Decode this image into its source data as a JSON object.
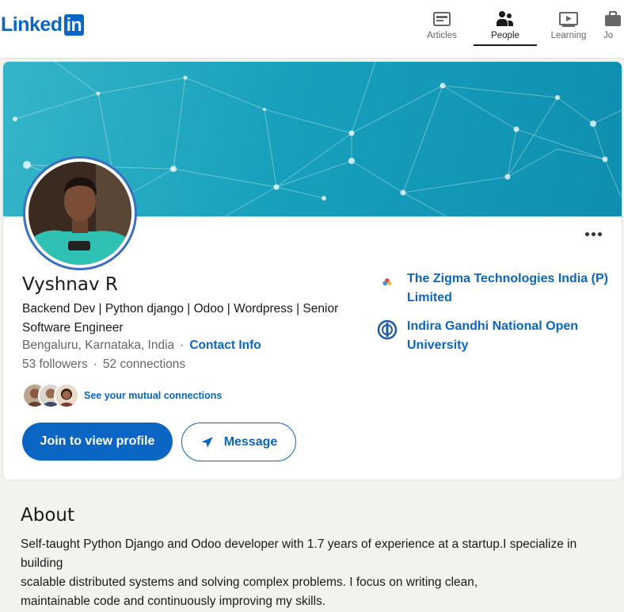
{
  "header": {
    "logo_text": "Linked",
    "logo_in": "in",
    "nav": [
      {
        "label": "Articles",
        "icon": "articles-icon",
        "active": false
      },
      {
        "label": "People",
        "icon": "people-icon",
        "active": true
      },
      {
        "label": "Learning",
        "icon": "learning-icon",
        "active": false
      },
      {
        "label": "Jo",
        "icon": "jobs-icon",
        "active": false
      }
    ]
  },
  "profile": {
    "name": "Vyshnav R",
    "headline_line1": "Backend Dev | Python django | Odoo | Wordpress | Senior",
    "headline_line2": "Software Engineer",
    "location": "Bengaluru, Karnataka, India",
    "separator": "·",
    "contact_info": "Contact Info",
    "followers": "53 followers",
    "connections": "52 connections",
    "mutual_link": "See your mutual connections",
    "join_button": "Join to view profile",
    "message_button": "Message"
  },
  "experience": [
    {
      "line1": "The Zigma Technologies India (P)",
      "line2": "Limited",
      "icon": "zigma-logo-icon"
    },
    {
      "line1": "Indira Gandhi National Open",
      "line2": "University",
      "icon": "ignou-logo-icon"
    }
  ],
  "about": {
    "title": "About",
    "lines": [
      "Self-taught Python Django and Odoo developer with 1.7 years of experience at a startup.I specialize in",
      "building",
      "scalable distributed systems and solving complex problems. I focus on writing clean,",
      "maintainable code and continuously improving my skills."
    ]
  },
  "colors": {
    "brand": "#0a66c2",
    "banner": "#17a0bd",
    "page_bg": "#f4f2ee"
  }
}
